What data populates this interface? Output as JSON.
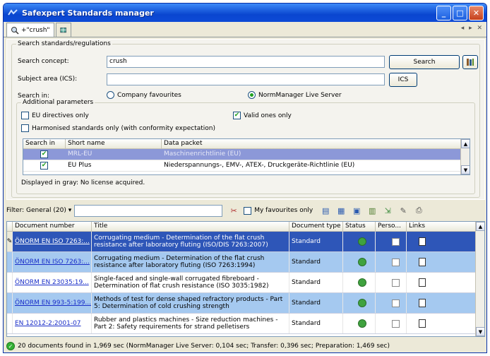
{
  "window": {
    "title": "Safexpert Standards manager",
    "minimize": "_",
    "maximize": "□",
    "close": "✕"
  },
  "tabs": [
    {
      "label": "+\"crush\""
    }
  ],
  "tabnav": "◂ ▸ ✕",
  "search": {
    "group_label": "Search standards/regulations",
    "concept_label": "Search concept:",
    "concept_value": "crush",
    "search_button": "Search",
    "subject_label": "Subject area (ICS):",
    "subject_value": "",
    "ics_button": "ICS",
    "searchin_label": "Search in:",
    "radio_company": "Company favourites",
    "radio_normmanager": "NormManager Live Server",
    "selected_radio": "normmanager"
  },
  "additional": {
    "label": "Additional parameters",
    "eu_directives": "EU directives only",
    "valid_only": "Valid ones only",
    "harmonised": "Harmonised standards only (with conformity expectation)",
    "columns": [
      "Search in",
      "Short name",
      "Data packet"
    ],
    "rows": [
      {
        "checked": true,
        "short": "MRL-EU",
        "packet": "Maschinenrichtlinie (EU)",
        "selected": true
      },
      {
        "checked": true,
        "short": "EU Plus",
        "packet": "Niederspannungs-, EMV-, ATEX-, Druckgeräte-Richtlinie (EU)",
        "selected": false
      }
    ],
    "note": "Displayed in gray: No license acquired."
  },
  "filter": {
    "label": "Filter: General (20)",
    "value": "",
    "favourites_only": "My favourites only"
  },
  "results": {
    "columns": [
      "Document number",
      "Title",
      "Document type",
      "Status",
      "Perso...",
      "Links"
    ],
    "rows": [
      {
        "number": "ÖNORM EN ISO 7263:...",
        "title": "Corrugating medium - Determination of the flat crush resistance after laboratory fluting (ISO/DIS 7263:2007)",
        "type": "Standard",
        "style": "sel"
      },
      {
        "number": "ÖNORM EN ISO 7263:...",
        "title": "Corrugating medium - Determination of the flat crush resistance after laboratory fluting (ISO 7263:1994)",
        "type": "Standard",
        "style": "alt"
      },
      {
        "number": "ÖNORM EN 23035:19...",
        "title": "Single-faced and single-wall corrugated fibreboard - Determination of flat crush resistance (ISO 3035:1982)",
        "type": "Standard",
        "style": "white"
      },
      {
        "number": "ÖNORM EN 993-5:199...",
        "title": "Methods of test for dense shaped refractory products - Part 5: Determination of cold crushing strength",
        "type": "Standard",
        "style": "alt"
      },
      {
        "number": "EN 12012-2:2001-07",
        "title": "Rubber and plastics machines - Size reduction machines - Part 2: Safety requirements for strand pelletisers",
        "type": "Standard",
        "style": "white"
      }
    ]
  },
  "status_text": "20 documents found in 1,969 sec (NormManager Live Server: 0,104 sec; Transfer: 0,396 sec; Preparation: 1,469 sec)"
}
